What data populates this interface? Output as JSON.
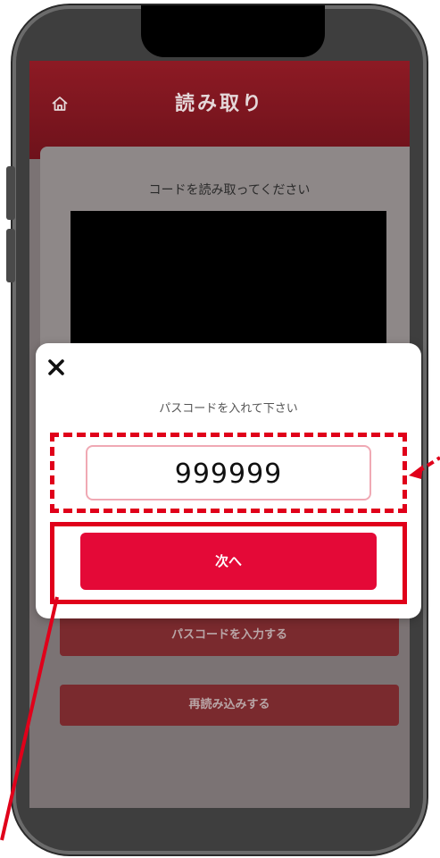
{
  "header": {
    "title": "読み取り",
    "home_icon": "home-icon"
  },
  "scanner": {
    "instruction": "コードを読み取ってください"
  },
  "background_buttons": {
    "passcode_input": "パスコードを入力する",
    "rescan": "再読み込みする"
  },
  "dialog": {
    "close_icon": "close-icon",
    "prompt": "パスコードを入れて下さい",
    "code_value": "999999",
    "next_label": "次へ"
  },
  "colors": {
    "header_red": "#8d1a24",
    "primary_button": "#e40937",
    "highlight": "#e0001a",
    "input_border": "#f0a9b4"
  }
}
